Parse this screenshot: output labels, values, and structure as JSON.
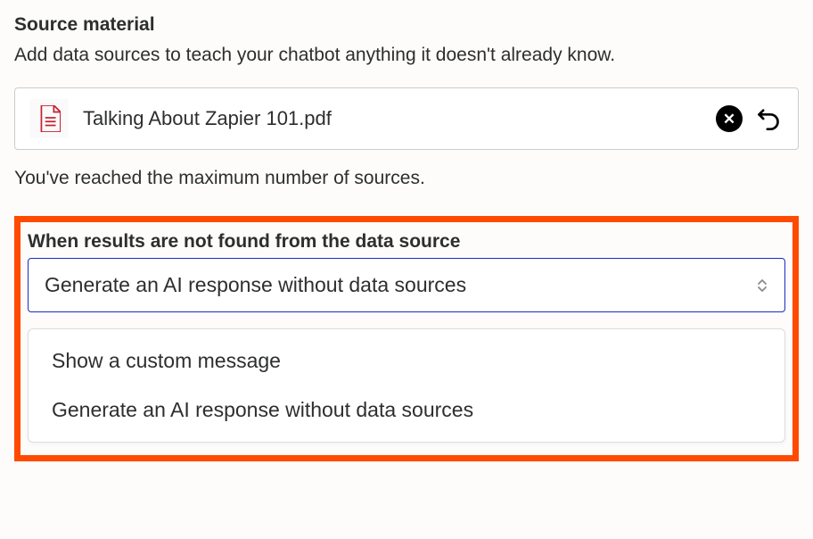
{
  "source_material": {
    "title": "Source material",
    "subtitle": "Add data sources to teach your chatbot anything it doesn't already know.",
    "file": {
      "name": "Talking About Zapier 101.pdf",
      "icon": "pdf-file-icon"
    },
    "max_notice": "You've reached the maximum number of sources."
  },
  "fallback": {
    "label": "When results are not found from the data source",
    "selected": "Generate an AI response without data sources",
    "options": [
      "Show a custom message",
      "Generate an AI response without data sources"
    ]
  }
}
